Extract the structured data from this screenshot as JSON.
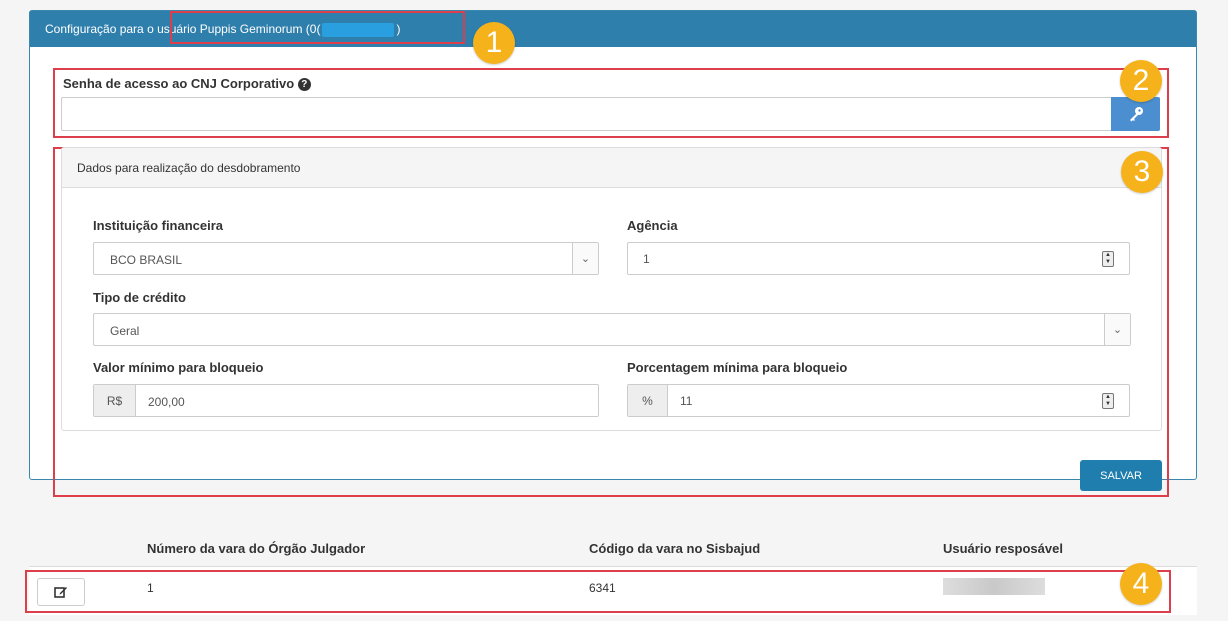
{
  "header": {
    "title_prefix": "Configuração para o usuário Puppis Geminorum (0(",
    "title_suffix": ")"
  },
  "password": {
    "label": "Senha de acesso ao CNJ Corporativo",
    "value": ""
  },
  "split": {
    "panel_title": "Dados para realização do desdobramento",
    "institution": {
      "label": "Instituição financeira",
      "value": "BCO BRASIL"
    },
    "agency": {
      "label": "Agência",
      "value": "1"
    },
    "credit_type": {
      "label": "Tipo de crédito",
      "value": "Geral"
    },
    "min_value": {
      "label": "Valor mínimo para bloqueio",
      "prefix": "R$",
      "value": "200,00"
    },
    "min_percent": {
      "label": "Porcentagem mínima para bloqueio",
      "prefix": "%",
      "value": "11"
    },
    "save_label": "SALVAR"
  },
  "table": {
    "headers": [
      "Número da vara do Órgão Julgador",
      "Código da vara no Sisbajud",
      "Usuário resposável"
    ],
    "rows": [
      {
        "vara": "1",
        "codigo": "6341"
      }
    ]
  },
  "badges": [
    "1",
    "2",
    "3",
    "4"
  ],
  "colors": {
    "header": "#2f7fad",
    "highlight": "#dc3f4b",
    "badge": "#f5b21b",
    "button": "#1f7eae"
  }
}
